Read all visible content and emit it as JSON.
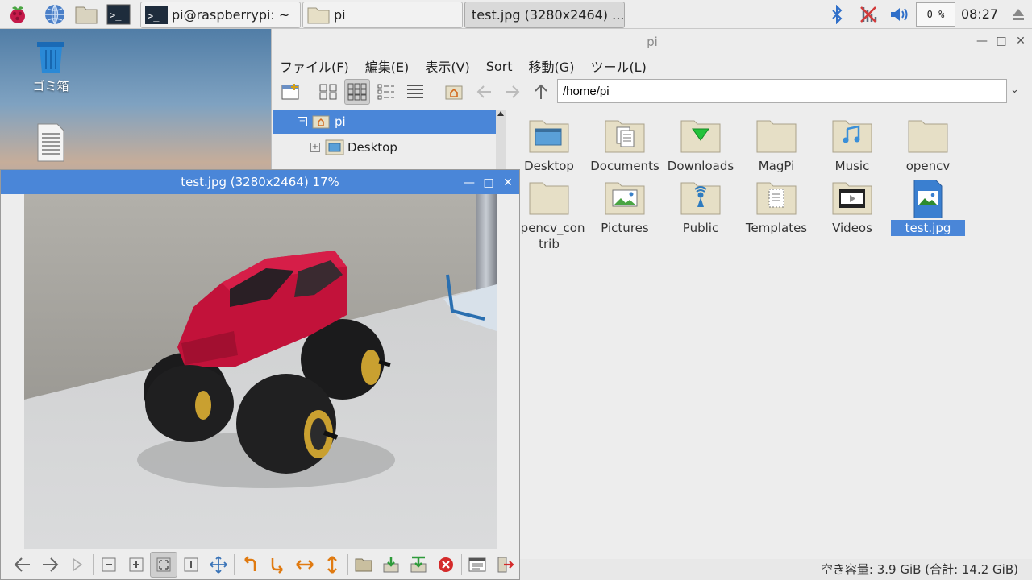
{
  "panel": {
    "tasks": [
      "pi@raspberrypi: ~",
      "pi",
      "test.jpg (3280x2464) ..."
    ],
    "cpu": "0 %",
    "clock": "08:27"
  },
  "desktop": {
    "trash_label": "ゴミ箱"
  },
  "file_manager": {
    "title": "pi",
    "menu": [
      "ファイル(F)",
      "編集(E)",
      "表示(V)",
      "Sort",
      "移動(G)",
      "ツール(L)"
    ],
    "path": "/home/pi",
    "tree": [
      "pi",
      "Desktop"
    ],
    "files": [
      "Desktop",
      "Documents",
      "Downloads",
      "MagPi",
      "Music",
      "opencv",
      "opencv_contrib",
      "Pictures",
      "Public",
      "Templates",
      "Videos",
      "test.jpg"
    ],
    "status": "空き容量: 3.9 GiB (合計: 14.2 GiB)",
    "accent": "#4a86d8"
  },
  "viewer": {
    "title": "test.jpg (3280x2464) 17%"
  }
}
